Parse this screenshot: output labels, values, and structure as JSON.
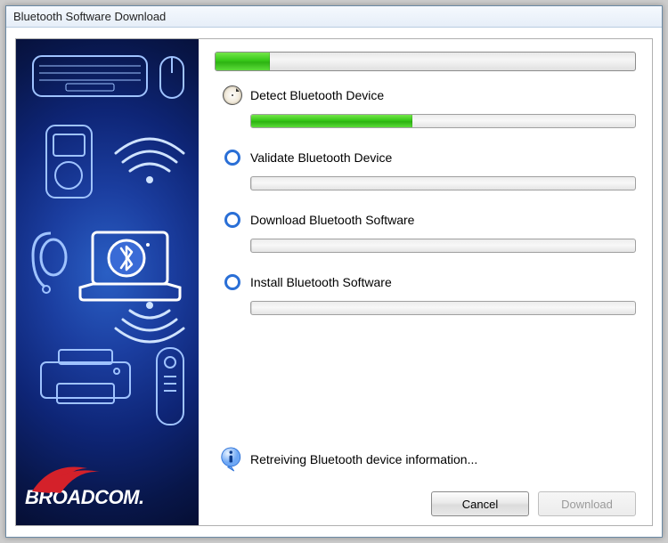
{
  "title": "Bluetooth Software Download",
  "brand": "BROADCOM.",
  "overall_progress_pct": 13,
  "steps": [
    {
      "label": "Detect Bluetooth Device",
      "state": "active",
      "progress_pct": 42
    },
    {
      "label": "Validate Bluetooth Device",
      "state": "pending",
      "progress_pct": 0
    },
    {
      "label": "Download Bluetooth Software",
      "state": "pending",
      "progress_pct": 0
    },
    {
      "label": "Install Bluetooth Software",
      "state": "pending",
      "progress_pct": 0
    }
  ],
  "status_text": "Retreiving Bluetooth device information...",
  "buttons": {
    "cancel": "Cancel",
    "download": "Download"
  },
  "download_enabled": false
}
